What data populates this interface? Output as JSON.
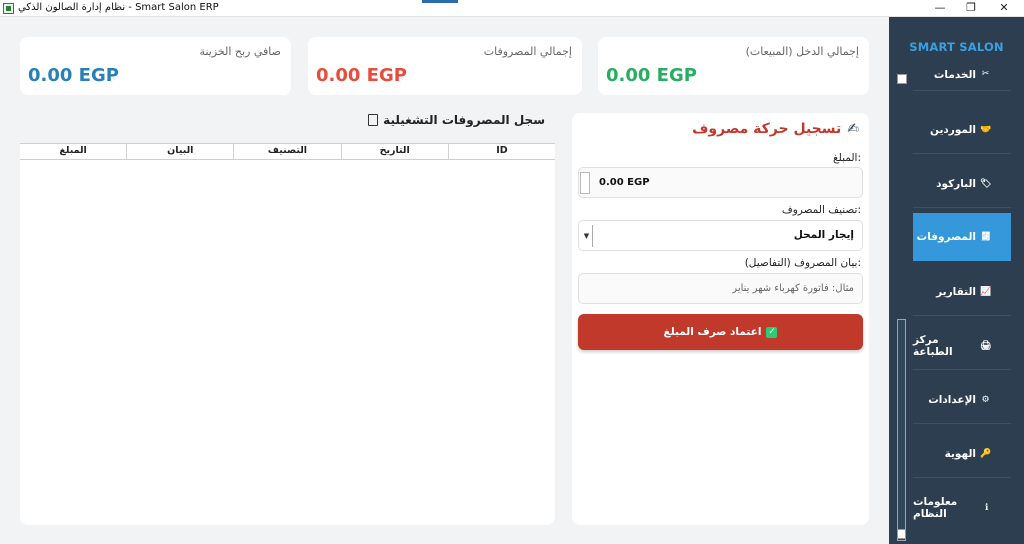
{
  "window": {
    "title": "نظام إدارة الصالون الذكي - Smart Salon ERP",
    "minimize": "—",
    "maximize": "❐",
    "close": "✕"
  },
  "sidebar": {
    "brand": "SMART SALON",
    "items": [
      {
        "label": "الخدمات",
        "icon": "scissors-icon",
        "glyph": "✂"
      },
      {
        "label": "الموردين",
        "icon": "handshake-icon",
        "glyph": "🤝"
      },
      {
        "label": "الباركود",
        "icon": "tag-icon",
        "glyph": "🏷"
      },
      {
        "label": "المصروفات",
        "icon": "receipt-icon",
        "glyph": "🧾"
      },
      {
        "label": "التقارير",
        "icon": "chart-icon",
        "glyph": "📈"
      },
      {
        "label": "مركز الطباعة",
        "icon": "printer-icon",
        "glyph": "🖨"
      },
      {
        "label": "الإعدادات",
        "icon": "gear-icon",
        "glyph": "⚙"
      },
      {
        "label": "الهوية",
        "icon": "key-icon",
        "glyph": "🔑"
      },
      {
        "label": "معلومات النظام",
        "icon": "info-icon",
        "glyph": "ℹ"
      }
    ],
    "active_index": 3
  },
  "stats": {
    "income": {
      "label": "إجمالي الدخل (المبيعات)",
      "value": "0.00 EGP",
      "color": "#27ae60"
    },
    "expenses": {
      "label": "إجمالي المصروفات",
      "value": "0.00 EGP",
      "color": "#e74c3c"
    },
    "net": {
      "label": "صافي ربح الخزينة",
      "value": "0.00 EGP",
      "color": "#2980b9"
    }
  },
  "form": {
    "title": "تسجيل حركة مصروف",
    "title_icon": "✍",
    "amount_label": "المبلغ:",
    "amount_value": "0.00 EGP",
    "category_label": "تصنيف المصروف:",
    "category_value": "إيجار المحل",
    "details_label": "بيان المصروف (التفاصيل):",
    "details_placeholder": "مثال: فاتورة كهرباء شهر يناير",
    "submit_label": "اعتماد صرف المبلغ",
    "submit_icon": "✓"
  },
  "log": {
    "title": "سجل المصروفات التشغيلية",
    "title_icon": "📋",
    "columns": [
      "ID",
      "التاريخ",
      "التصنيف",
      "البيان",
      "المبلغ"
    ],
    "rows": []
  },
  "colors": {
    "sidebar_bg": "#2c3e50",
    "active_nav": "#3498db",
    "brand": "#3aa0e0",
    "danger": "#c0392b"
  }
}
